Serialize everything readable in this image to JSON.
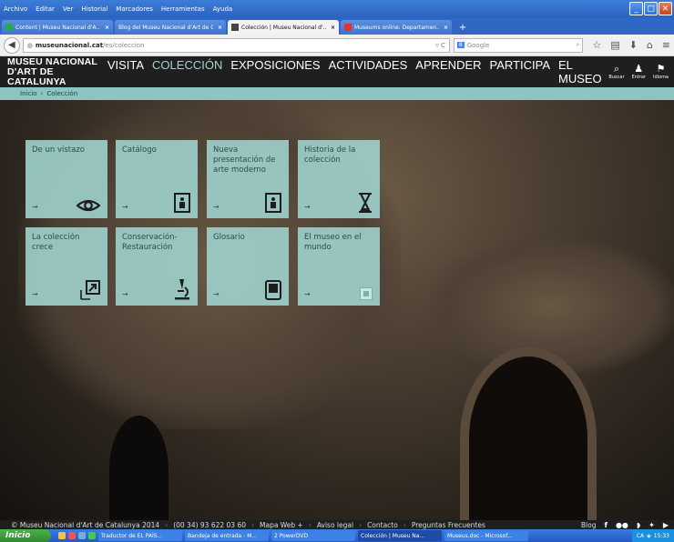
{
  "browser": {
    "menu": [
      "Archivo",
      "Editar",
      "Ver",
      "Historial",
      "Marcadores",
      "Herramientas",
      "Ayuda"
    ],
    "tabs": [
      {
        "label": "Content | Museu Nacional d'A...",
        "active": false
      },
      {
        "label": "Blog del Museu Nacional d'Art de C...",
        "active": false
      },
      {
        "label": "Colección | Museu Nacional d'...",
        "active": true
      },
      {
        "label": "Museums online. Departamen...",
        "active": false
      }
    ],
    "url_host": "museunacional.cat",
    "url_path": "/es/coleccion",
    "search_engine": "Google",
    "search_placeholder": "Google"
  },
  "site": {
    "logo_line1": "MUSEU NACIONAL",
    "logo_line2": "D'ART DE CATALUNYA",
    "nav": [
      {
        "label": "VISITA",
        "active": false
      },
      {
        "label": "COLECCIÓN",
        "active": true
      },
      {
        "label": "EXPOSICIONES",
        "active": false
      },
      {
        "label": "ACTIVIDADES",
        "active": false
      },
      {
        "label": "APRENDER",
        "active": false
      },
      {
        "label": "PARTICIPA",
        "active": false
      },
      {
        "label": "EL MUSEO",
        "active": false
      }
    ],
    "header_icons": [
      {
        "label": "Buscar",
        "icon": "search-icon"
      },
      {
        "label": "Entrar",
        "icon": "user-icon"
      },
      {
        "label": "Idioma",
        "icon": "flag-icon"
      }
    ],
    "breadcrumb": {
      "home": "Inicio",
      "separator": "›",
      "current": "Colección"
    },
    "tiles": [
      {
        "title": "De un vistazo",
        "icon": "eye-icon"
      },
      {
        "title": "Catálogo",
        "icon": "frame-icon"
      },
      {
        "title": "Nueva presentación de arte moderno",
        "icon": "frame-icon"
      },
      {
        "title": "Historia de la colección",
        "icon": "hourglass-icon"
      },
      {
        "title": "La colección crece",
        "icon": "expand-icon"
      },
      {
        "title": "Conservación-Restauración",
        "icon": "microscope-icon"
      },
      {
        "title": "Glosario",
        "icon": "book-icon"
      },
      {
        "title": "El museo en el mundo",
        "icon": "globe-icon"
      }
    ],
    "tile_arrow": "→",
    "accent_color": "#9fd6d0",
    "tile_color": "#9ccec8"
  },
  "footer": {
    "copyright": "© Museu Nacional d'Art de Catalunya 2014",
    "phone": "(00 34) 93 622 03 60",
    "links": [
      "Mapa Web +",
      "Aviso legal",
      "Contacto",
      "Preguntas Frecuentes"
    ],
    "separator": "›",
    "blog": "Blog"
  },
  "taskbar": {
    "start": "Inicio",
    "tasks": [
      {
        "label": "Traductor de EL PAÍS...",
        "active": false
      },
      {
        "label": "Bandeja de entrada - M...",
        "active": false
      },
      {
        "label": "2 PowerDVD",
        "active": false
      },
      {
        "label": "Colección | Museu Na...",
        "active": true
      },
      {
        "label": "Museus.doc - Microsof...",
        "active": false
      }
    ],
    "lang": "CA",
    "clock": "15:33"
  }
}
